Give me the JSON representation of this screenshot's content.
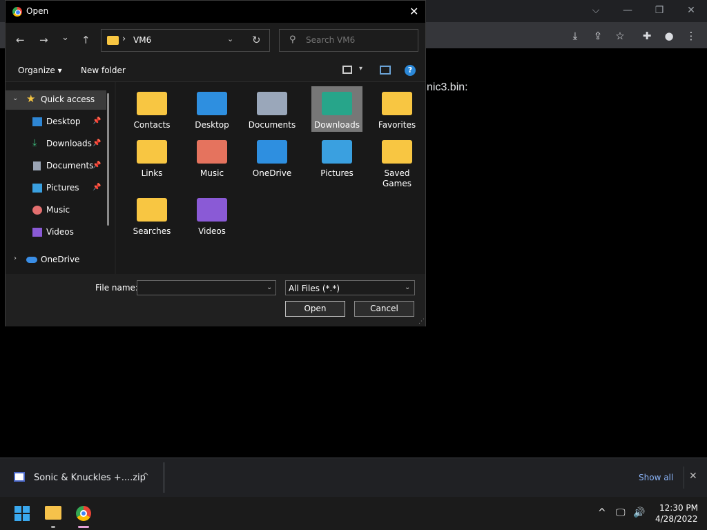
{
  "browser": {
    "page_text": "nic3.bin:",
    "controls": {
      "chevron": "⌵",
      "minimize": "—",
      "restore": "❐",
      "close": "✕"
    },
    "toolbar_icons": {
      "download": "⤓",
      "share": "⇪",
      "bookmark": "☆",
      "extensions": "✚",
      "profile": "●",
      "menu": "⋮"
    }
  },
  "dialog": {
    "title": "Open",
    "close_glyph": "✕",
    "nav": {
      "back": "←",
      "forward": "→",
      "recent": "⌄",
      "up": "↑"
    },
    "address": {
      "chevron": "›",
      "path": "VM6",
      "dropdown": "⌄",
      "refresh": "↻"
    },
    "search": {
      "icon": "⚲",
      "placeholder": "Search VM6"
    },
    "command_bar": {
      "organize": "Organize ▾",
      "new_folder": "New folder",
      "view_drop": "▾",
      "help": "?"
    },
    "sidebar": {
      "quick_access": "Quick access",
      "expander_open": "⌄",
      "expander_closed": "›",
      "pin": "📌",
      "items": [
        {
          "label": "Desktop",
          "pinned": true
        },
        {
          "label": "Downloads",
          "pinned": true
        },
        {
          "label": "Documents",
          "pinned": true
        },
        {
          "label": "Pictures",
          "pinned": true
        },
        {
          "label": "Music",
          "pinned": false
        },
        {
          "label": "Videos",
          "pinned": false
        }
      ],
      "onedrive": "OneDrive"
    },
    "folders": [
      {
        "label": "Contacts"
      },
      {
        "label": "Desktop"
      },
      {
        "label": "Documents"
      },
      {
        "label": "Downloads",
        "selected": true
      },
      {
        "label": "Favorites"
      },
      {
        "label": "Links"
      },
      {
        "label": "Music"
      },
      {
        "label": "OneDrive"
      },
      {
        "label": "Pictures"
      },
      {
        "label": "Saved Games"
      },
      {
        "label": "Searches"
      },
      {
        "label": "Videos"
      }
    ],
    "footer": {
      "file_name_label": "File name:",
      "file_name_value": "",
      "dropdown": "⌄",
      "filter_value": "All Files (*.*)",
      "open_label": "Open",
      "cancel_label": "Cancel",
      "grip": "⋰"
    }
  },
  "download_bar": {
    "file_name": "Sonic & Knuckles +....zip",
    "caret": "^",
    "show_all": "Show all",
    "close": "✕"
  },
  "taskbar": {
    "tray": {
      "chevron": "^",
      "network": "🖵",
      "volume": "🔊"
    },
    "time": "12:30 PM",
    "date": "4/28/2022"
  }
}
